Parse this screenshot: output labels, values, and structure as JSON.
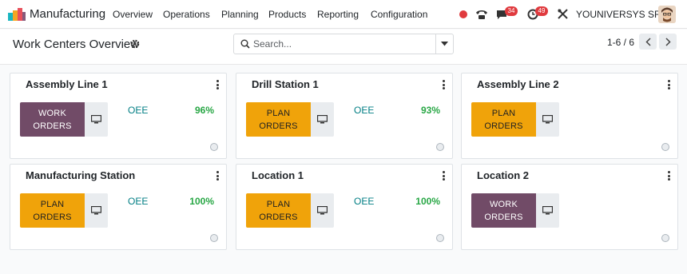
{
  "navbar": {
    "app_name": "Manufacturing",
    "menu": [
      "Overview",
      "Operations",
      "Planning",
      "Products",
      "Reporting",
      "Configuration"
    ],
    "messages_count": "34",
    "activities_count": "49",
    "company": "YOUNIVERSYS SRL"
  },
  "control_panel": {
    "title": "Work Centers Overview",
    "search_placeholder": "Search...",
    "pager": "1-6 / 6"
  },
  "cards": [
    {
      "title": "Assembly Line 1",
      "button": "WORK ORDERS",
      "button_type": "work",
      "oee_label": "OEE",
      "oee_value": "96%"
    },
    {
      "title": "Drill Station 1",
      "button": "PLAN ORDERS",
      "button_type": "plan",
      "oee_label": "OEE",
      "oee_value": "93%"
    },
    {
      "title": "Assembly Line 2",
      "button": "PLAN ORDERS",
      "button_type": "plan",
      "oee_label": "",
      "oee_value": ""
    },
    {
      "title": "Manufacturing Station",
      "button": "PLAN ORDERS",
      "button_type": "plan",
      "oee_label": "OEE",
      "oee_value": "100%"
    },
    {
      "title": "Location 1",
      "button": "PLAN ORDERS",
      "button_type": "plan",
      "oee_label": "OEE",
      "oee_value": "100%"
    },
    {
      "title": "Location 2",
      "button": "WORK ORDERS",
      "button_type": "work",
      "oee_label": "",
      "oee_value": ""
    }
  ],
  "colors": {
    "work_button": "#714b67",
    "plan_button": "#f0a30a",
    "oee_label": "#017e84",
    "oee_value": "#28a745",
    "badge": "#e03a3e"
  }
}
